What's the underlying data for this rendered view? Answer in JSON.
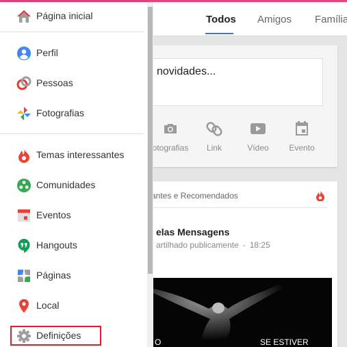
{
  "colors": {
    "accent": "#3f73d6",
    "topbar": "#ec407a",
    "highlight": "#e21b2b",
    "hot": "#ea4335"
  },
  "header": {
    "tabs": [
      {
        "label": "Todos",
        "active": true
      },
      {
        "label": "Amigos",
        "active": false
      },
      {
        "label": "Família",
        "active": false
      }
    ]
  },
  "share": {
    "prompt": "novidades...",
    "actions": [
      {
        "label": "otografias",
        "icon": "camera-icon"
      },
      {
        "label": "Link",
        "icon": "link-icon"
      },
      {
        "label": "Vídeo",
        "icon": "video-icon"
      },
      {
        "label": "Evento",
        "icon": "event-icon"
      }
    ]
  },
  "post": {
    "section_title": "santes e Recomendados",
    "author": "elas Mensagens",
    "visibility": "artilhado publicamente",
    "time": "18:25",
    "caption_left": "O",
    "caption_right": "SE ESTIVER"
  },
  "sidebar": {
    "items": [
      {
        "label": "Página inicial",
        "icon": "home-icon"
      },
      {
        "label": "Perfil",
        "icon": "profile-icon"
      },
      {
        "label": "Pessoas",
        "icon": "people-icon"
      },
      {
        "label": "Fotografias",
        "icon": "photos-icon"
      },
      {
        "label": "Temas interessantes",
        "icon": "flame-icon"
      },
      {
        "label": "Comunidades",
        "icon": "communities-icon"
      },
      {
        "label": "Eventos",
        "icon": "calendar-icon"
      },
      {
        "label": "Hangouts",
        "icon": "hangouts-icon"
      },
      {
        "label": "Páginas",
        "icon": "pages-icon"
      },
      {
        "label": "Local",
        "icon": "location-pin-icon"
      },
      {
        "label": "Definições",
        "icon": "gear-icon",
        "highlighted": true
      }
    ]
  }
}
